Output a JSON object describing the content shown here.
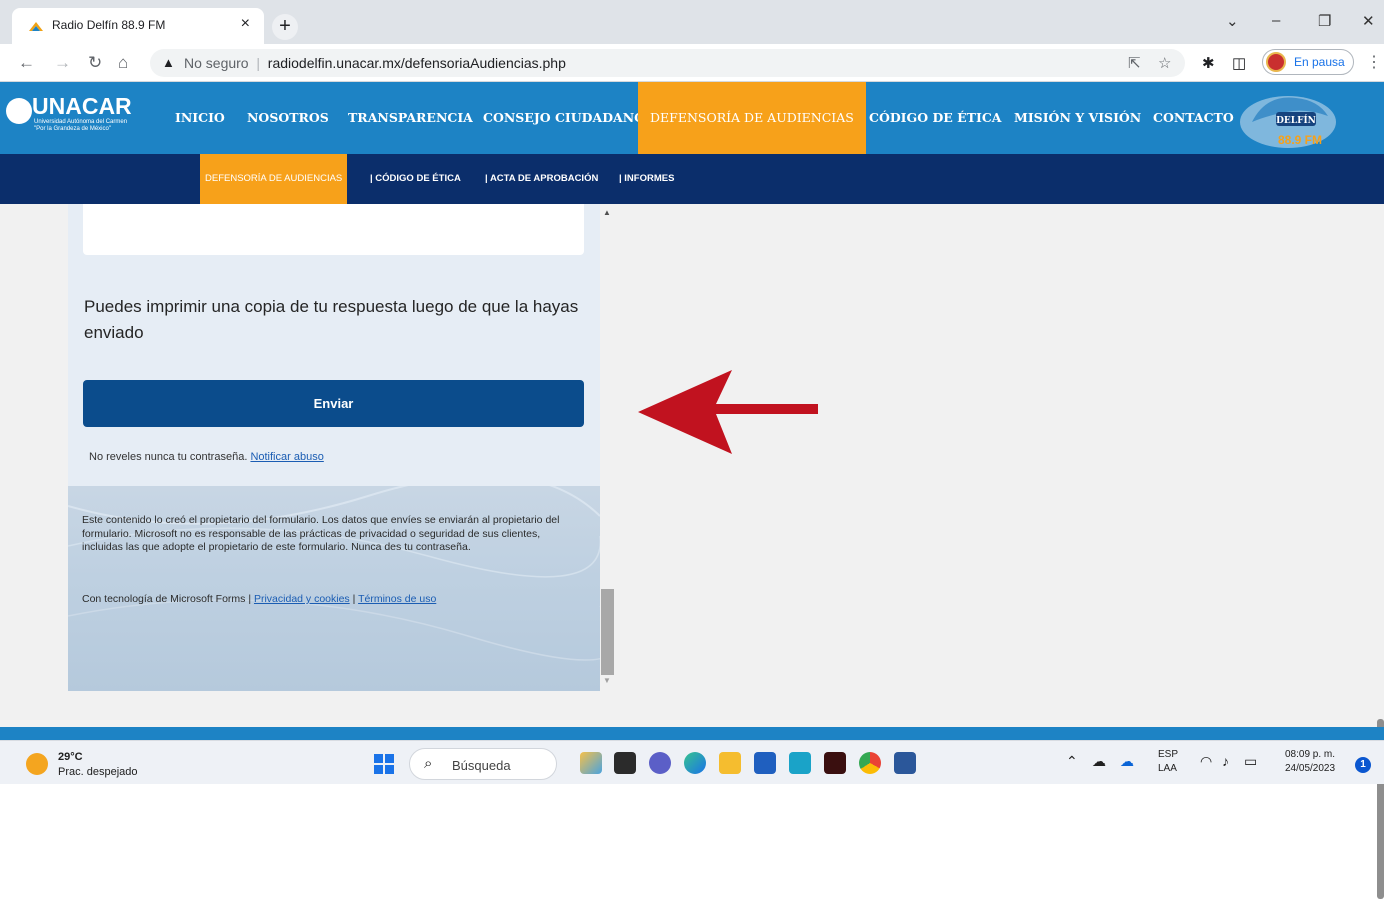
{
  "browser": {
    "tab_title": "Radio Delfín 88.9 FM",
    "tab_close": "×",
    "new_tab": "+",
    "window_controls": {
      "chevron": "⌄",
      "minimize": "–",
      "restore": "❐",
      "close": "✕"
    },
    "security_label": "No seguro",
    "url": "radiodelfin.unacar.mx/defensoriaAudiencias.php",
    "profile_status": "En pausa"
  },
  "site": {
    "logo_text": "UNACAR",
    "logo_subtitle_line1": "Universidad Autónoma del Carmen",
    "logo_subtitle_line2": "\"Por la Grandeza de México\"",
    "nav": [
      {
        "label": "INICIO"
      },
      {
        "label": "NOSOTROS"
      },
      {
        "label": "TRANSPARENCIA"
      },
      {
        "label": "CONSEJO CIUDADANO"
      },
      {
        "label": "DEFENSORÍA DE AUDIENCIAS",
        "active": true
      },
      {
        "label": "CÓDIGO DE ÉTICA"
      },
      {
        "label": "MISIÓN Y VISIÓN"
      },
      {
        "label": "CONTACTO"
      }
    ],
    "radio_logo_text": "DELFÍN",
    "radio_logo_freq": "88.9 FM",
    "subnav": [
      {
        "label": "DEFENSORÍA DE AUDIENCIAS",
        "active": true
      },
      {
        "label": "| CÓDIGO DE ÉTICA"
      },
      {
        "label": "| ACTA DE APROBACIÓN"
      },
      {
        "label": "| INFORMES"
      }
    ]
  },
  "form": {
    "print_note": "Puedes imprimir una copia de tu respuesta luego de que la hayas enviado",
    "submit_label": "Enviar",
    "password_note": "No reveles nunca tu contraseña.",
    "report_abuse": "Notificar abuso",
    "disclaimer": "Este contenido lo creó el propietario del formulario. Los datos que envíes se enviarán al propietario del formulario. Microsoft no es responsable de las prácticas de privacidad o seguridad de sus clientes, incluidas las que adopte el propietario de este formulario. Nunca des tu contraseña.",
    "powered_by": "Con tecnología de Microsoft Forms |",
    "privacy_link": "Privacidad y cookies",
    "separator": "|",
    "terms_link": "Términos de uso"
  },
  "annotation": {
    "arrow_color": "#c1121f"
  },
  "taskbar": {
    "weather_temp": "29°C",
    "weather_desc": "Prac. despejado",
    "search_label": "Búsqueda",
    "language_line1": "ESP",
    "language_line2": "LAA",
    "time": "08:09 p. m.",
    "date": "24/05/2023",
    "notification_count": "1"
  },
  "colors": {
    "site_blue": "#1d83c5",
    "site_navy": "#0b2e6b",
    "accent_orange": "#f7a11a",
    "submit_blue": "#0b4c8c"
  }
}
